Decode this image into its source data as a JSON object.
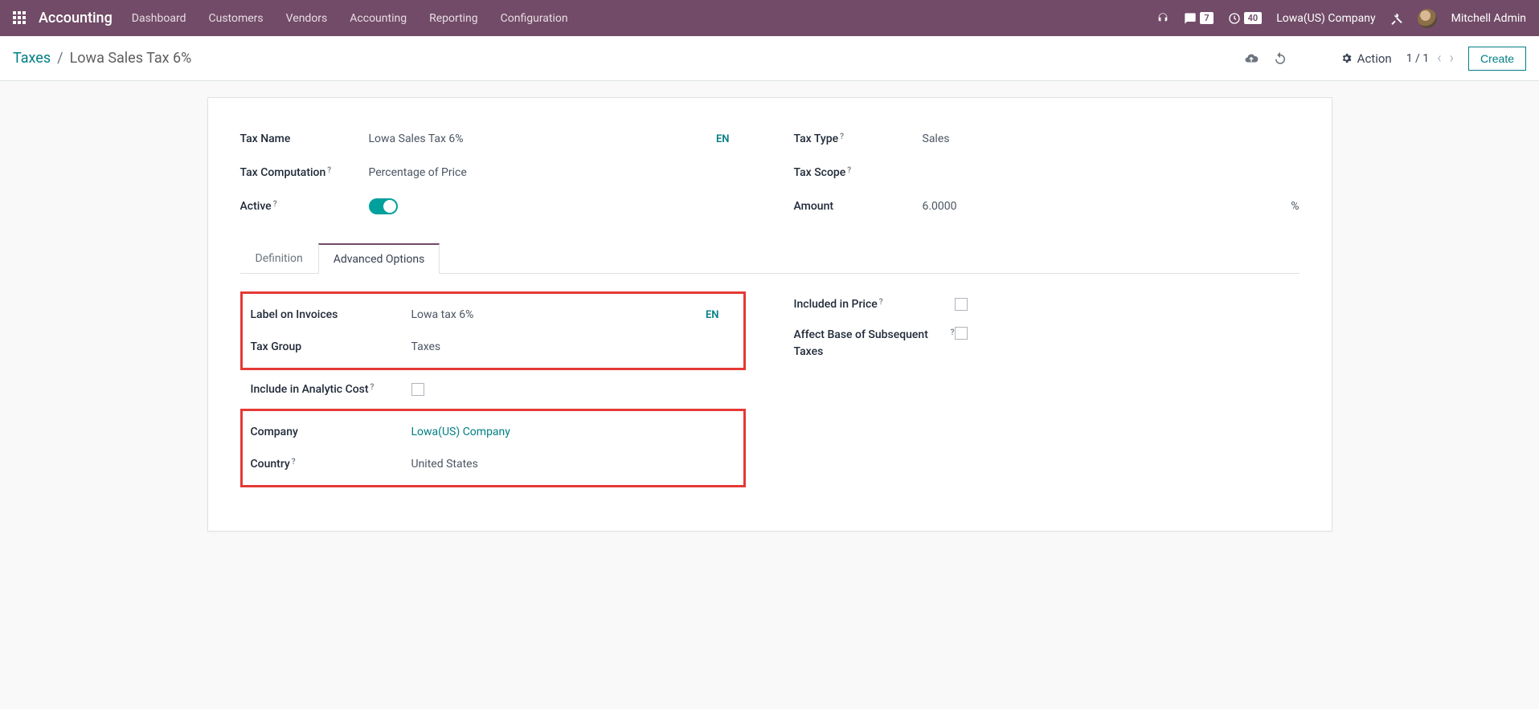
{
  "topnav": {
    "brand": "Accounting",
    "menu": [
      "Dashboard",
      "Customers",
      "Vendors",
      "Accounting",
      "Reporting",
      "Configuration"
    ],
    "msg_count": "7",
    "activity_count": "40",
    "company": "Lowa(US) Company",
    "user": "Mitchell Admin"
  },
  "controlbar": {
    "breadcrumb_root": "Taxes",
    "breadcrumb_sep": "/",
    "breadcrumb_cur": "Lowa Sales Tax 6%",
    "action_label": "Action",
    "pager": "1 / 1",
    "create": "Create"
  },
  "form": {
    "left": {
      "tax_name_label": "Tax Name",
      "tax_name_value": "Lowa Sales Tax 6%",
      "tax_name_lang": "EN",
      "tax_comp_label": "Tax Computation",
      "tax_comp_value": "Percentage of Price",
      "active_label": "Active"
    },
    "right": {
      "tax_type_label": "Tax Type",
      "tax_type_value": "Sales",
      "tax_scope_label": "Tax Scope",
      "amount_label": "Amount",
      "amount_value": "6.0000",
      "amount_suffix": "%"
    }
  },
  "tabs": {
    "definition": "Definition",
    "advanced": "Advanced Options"
  },
  "adv": {
    "left": {
      "label_invoices_label": "Label on Invoices",
      "label_invoices_value": "Lowa tax 6%",
      "label_invoices_lang": "EN",
      "tax_group_label": "Tax Group",
      "tax_group_value": "Taxes",
      "include_analytic_label": "Include in Analytic Cost",
      "company_label": "Company",
      "company_value": "Lowa(US) Company",
      "country_label": "Country",
      "country_value": "United States"
    },
    "right": {
      "included_price_label": "Included in Price",
      "affect_base_label": "Affect Base of Subsequent Taxes"
    }
  }
}
